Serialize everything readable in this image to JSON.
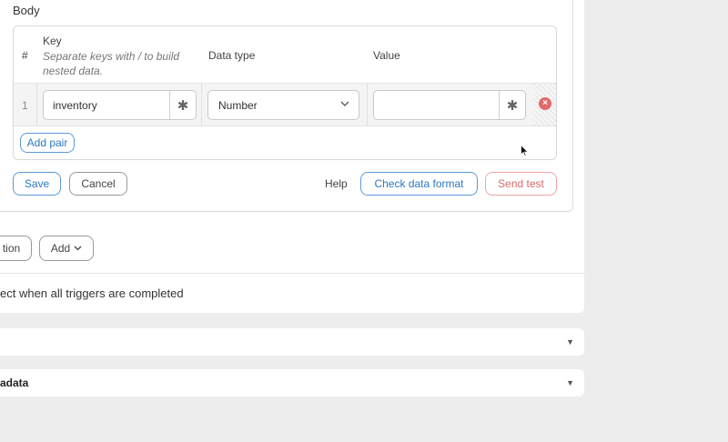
{
  "body_section": {
    "label": "Body",
    "table": {
      "col_index": "#",
      "col_key": "Key",
      "col_key_hint": "Separate keys with / to build nested data.",
      "col_data_type": "Data type",
      "col_value": "Value",
      "rows": [
        {
          "index": "1",
          "key": "inventory",
          "data_type": "Number",
          "value": ""
        }
      ],
      "add_pair_label": "Add pair"
    }
  },
  "actions": {
    "save_label": "Save",
    "cancel_label": "Cancel",
    "help_label": "Help",
    "check_format_label": "Check data format",
    "send_test_label": "Send test"
  },
  "step_actions": {
    "partial_button_label": "tion",
    "add_label": "Add"
  },
  "completion_text": "ect when all triggers are completed",
  "collapsibles": [
    {
      "label": ""
    },
    {
      "label": "adata"
    }
  ],
  "icons": {
    "remove": "remove-circle-icon",
    "wildcard": "asterisk-icon",
    "dropdown": "chevron-down-icon",
    "caret": "caret-down-icon",
    "cursor": "mouse-pointer-icon"
  },
  "colors": {
    "primary": "#2b79c2",
    "danger": "#d46b6b",
    "remove_icon": "#e06b6b"
  }
}
